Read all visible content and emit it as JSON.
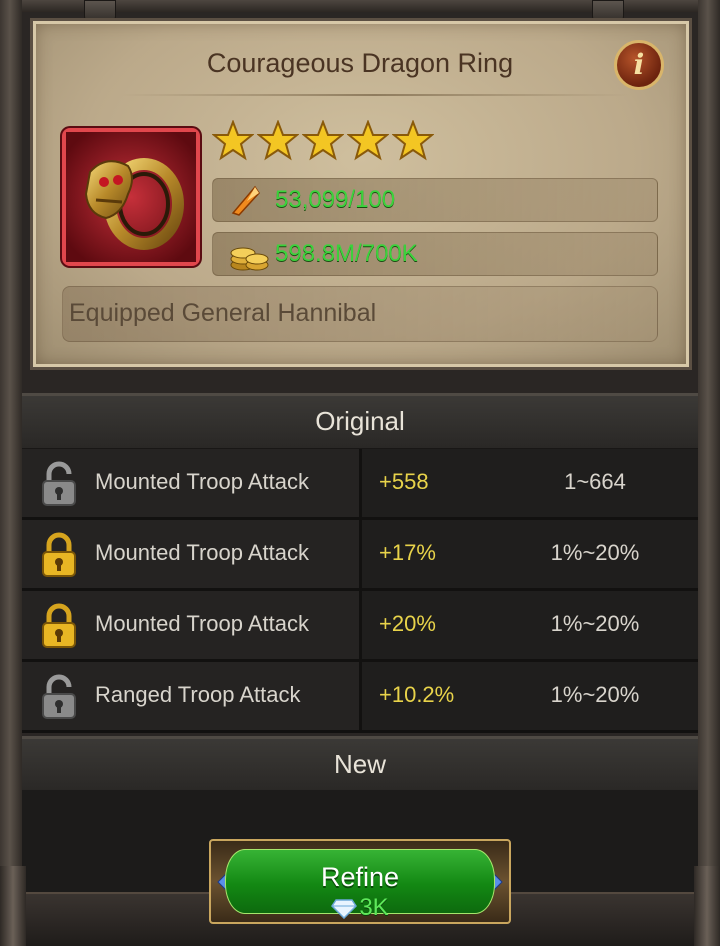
{
  "item": {
    "title": "Courageous Dragon Ring",
    "info_icon": "info-icon",
    "stars": 5,
    "materials": {
      "icon": "crystal-shard-icon",
      "value": "53,099/100"
    },
    "gold": {
      "icon": "gold-coins-icon",
      "value": "598.8M/700K"
    },
    "equipped_text": "Equipped General Hannibal"
  },
  "sections": {
    "original_label": "Original",
    "new_label": "New"
  },
  "stats": [
    {
      "lock": "unlocked",
      "name": "Mounted Troop Attack",
      "value": "+558",
      "range": "1~664"
    },
    {
      "lock": "locked",
      "name": "Mounted Troop Attack",
      "value": "+17%",
      "range": "1%~20%"
    },
    {
      "lock": "locked",
      "name": "Mounted Troop Attack",
      "value": "+20%",
      "range": "1%~20%"
    },
    {
      "lock": "unlocked",
      "name": "Ranged Troop Attack",
      "value": "+10.2%",
      "range": "1%~20%"
    }
  ],
  "refine": {
    "label": "Refine",
    "cost": "3K",
    "cost_icon": "diamond-icon"
  },
  "colors": {
    "resource_green": "#3cd23c",
    "stat_value_yellow": "#e8d34a",
    "button_green": "#138813"
  }
}
